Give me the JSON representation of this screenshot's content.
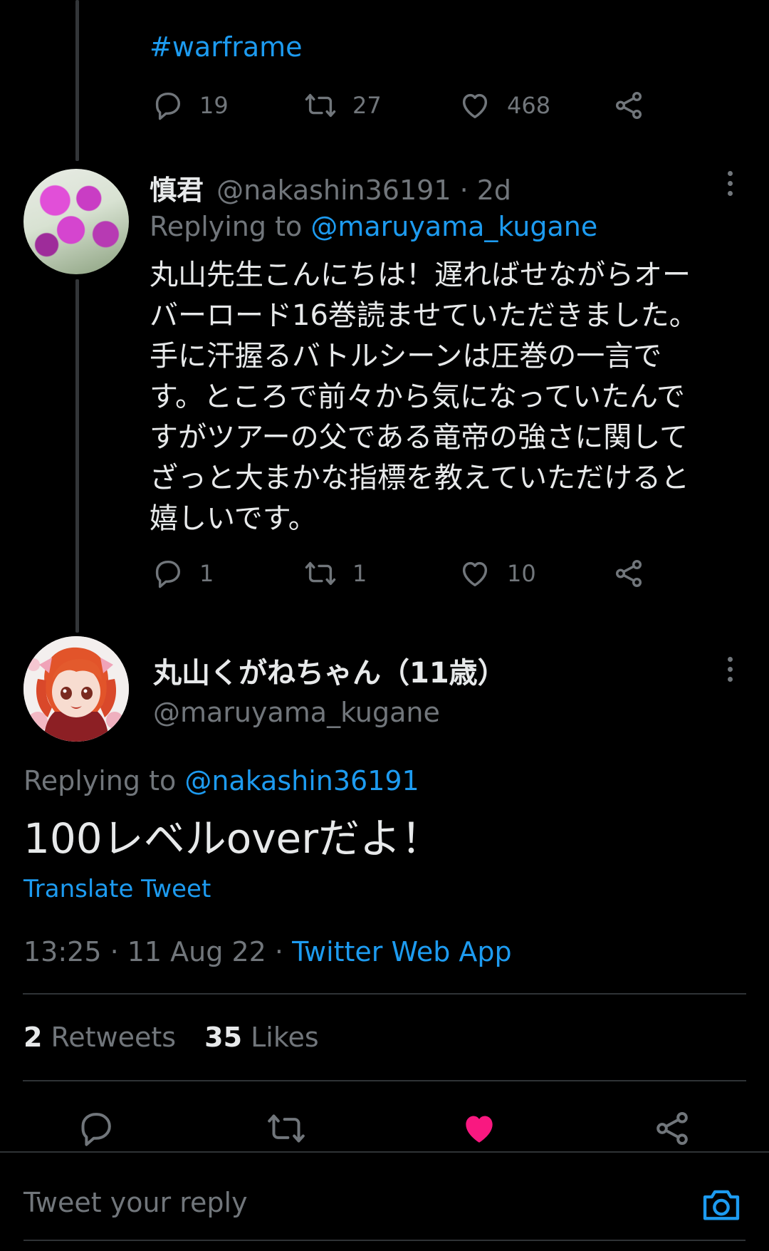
{
  "parent_tweet": {
    "hashtag": "#warframe",
    "replies": "19",
    "retweets": "27",
    "likes": "468"
  },
  "reply_tweet": {
    "display_name": "慎君",
    "handle_time": "@nakashin36191 · 2d",
    "replying_label": "Replying to",
    "replying_handle": "@maruyama_kugane",
    "text_lines": [
      "丸山先生こんにちは！遅ればせながらオー",
      "バーロード16巻読ませていただきました。",
      "手に汗握るバトルシーンは圧巻の一言で",
      "す。ところで前々から気になっていたんで",
      "すがツアーの父である竜帝の強さに関して",
      "ざっと大まかな指標を教えていただけると",
      "嬉しいです。"
    ],
    "replies": "1",
    "retweets": "1",
    "likes": "10"
  },
  "main_tweet": {
    "display_name": "丸山くがねちゃん（11歳）",
    "handle": "@maruyama_kugane",
    "replying_label": "Replying to",
    "replying_handle": "@nakashin36191",
    "text": "100レベルoverだよ！",
    "translate": "Translate Tweet",
    "timestamp": "13:25 · 11 Aug 22 · ",
    "source": "Twitter Web App",
    "retweet_count": "2",
    "retweet_label": "Retweets",
    "like_count": "35",
    "like_label": "Likes"
  },
  "reply_bar": {
    "placeholder": "Tweet your reply"
  },
  "colors": {
    "background": "#000000",
    "text": "#e7e9ea",
    "muted": "#71767b",
    "link": "#1d9bf0",
    "like_active": "#f91880",
    "divider": "#2f3336"
  }
}
